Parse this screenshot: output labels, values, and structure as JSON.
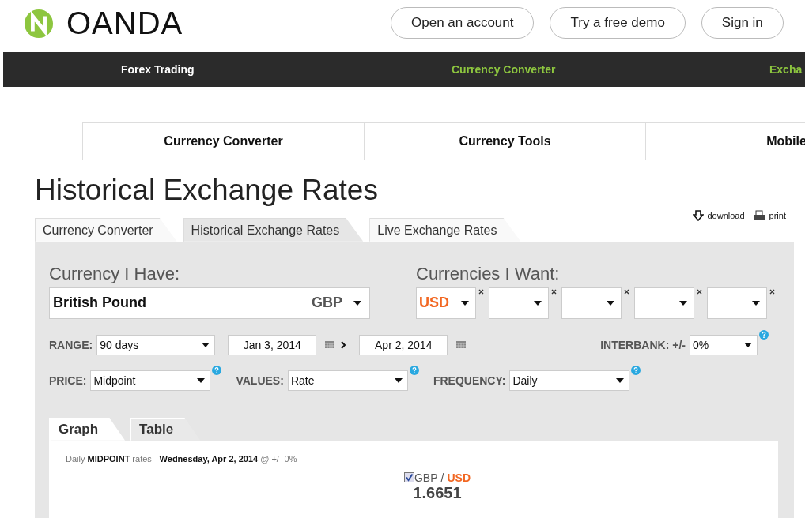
{
  "header": {
    "logo": "OANDA",
    "buttons": [
      "Open an account",
      "Try a free demo",
      "Sign in"
    ]
  },
  "nav": [
    {
      "label": "Forex Trading",
      "color": "#ffffff"
    },
    {
      "label": "Currency Converter",
      "color": "#8dc63f"
    },
    {
      "label": "Excha",
      "color": "#8dc63f"
    }
  ],
  "subnav": [
    "Currency Converter",
    "Currency Tools",
    "Mobile"
  ],
  "title": "Historical Exchange Rates",
  "tabs": [
    {
      "label": "Currency Converter",
      "selected": false
    },
    {
      "label": "Historical Exchange Rates",
      "selected": true
    },
    {
      "label": "Live Exchange Rates",
      "selected": false
    }
  ],
  "links": [
    {
      "kind": "download",
      "label": "download"
    },
    {
      "kind": "print",
      "label": "print"
    }
  ],
  "have": {
    "label": "Currency I Have:",
    "name": "British Pound",
    "code": "GBP"
  },
  "want": {
    "label": "Currencies I Want:",
    "slots": [
      {
        "value": "USD",
        "removable": true
      },
      {
        "removable": true
      },
      {
        "removable": true
      },
      {
        "removable": true
      },
      {
        "removable": true
      }
    ]
  },
  "range": {
    "label": "RANGE:",
    "value": "90 days",
    "from": "Jan 3, 2014",
    "to": "Apr 2, 2014"
  },
  "interbank": {
    "label": "INTERBANK: +/-",
    "value": "0%"
  },
  "options": [
    {
      "label": "PRICE:",
      "value": "Midpoint"
    },
    {
      "label": "VALUES:",
      "value": "Rate"
    },
    {
      "label": "FREQUENCY:",
      "value": "Daily"
    }
  ],
  "view_tabs": [
    {
      "label": "Graph",
      "selected": true
    },
    {
      "label": "Table",
      "selected": false
    }
  ],
  "caption": "Daily **MIDPOINT** rates - **Wednesday, Apr 2, 2014** @ +/- 0%",
  "legend": {
    "checked": true,
    "base": "GBP",
    "separator": "/",
    "quote": "USD",
    "rate": "1.6651"
  }
}
